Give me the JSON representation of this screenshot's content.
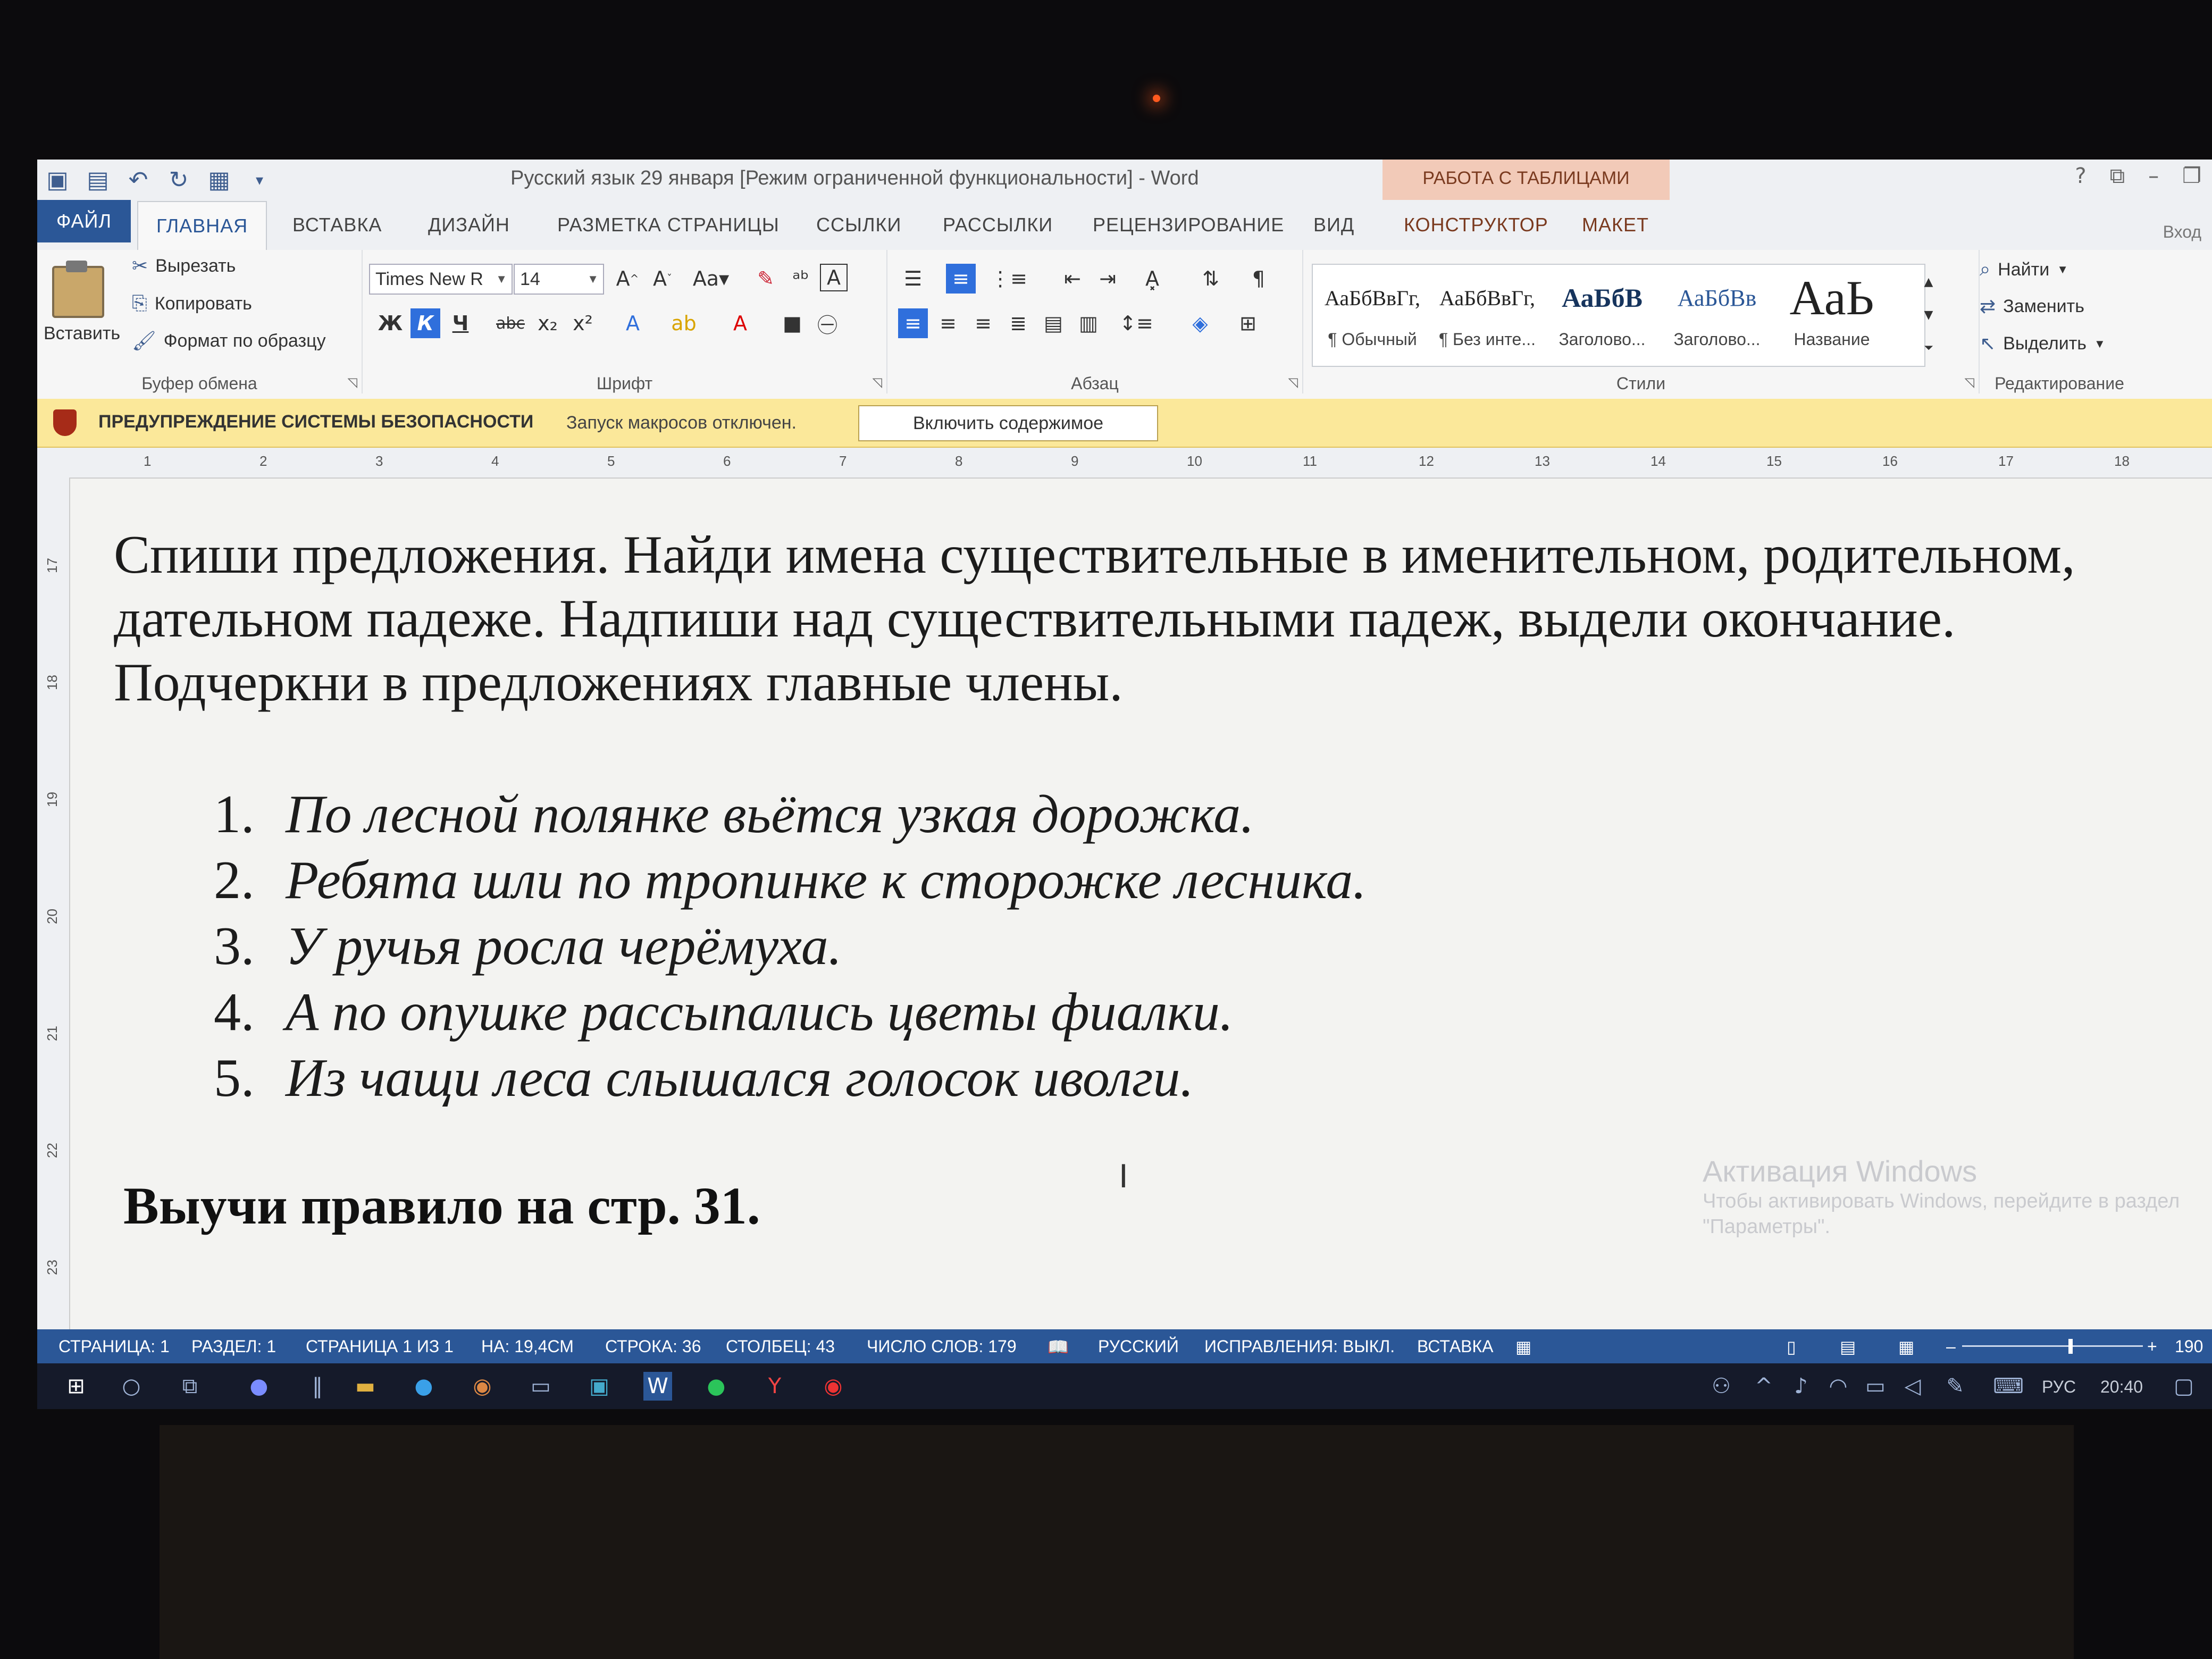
{
  "window": {
    "title": "Русский язык 29 января [Режим ограниченной функциональности] - Word",
    "context_group": "РАБОТА С ТАБЛИЦАМИ",
    "login": "Вход"
  },
  "tabs": {
    "file": "ФАЙЛ",
    "home": "ГЛАВНАЯ",
    "insert": "ВСТАВКА",
    "design": "ДИЗАЙН",
    "layout": "РАЗМЕТКА СТРАНИЦЫ",
    "references": "ССЫЛКИ",
    "mailings": "РАССЫЛКИ",
    "review": "РЕЦЕНЗИРОВАНИЕ",
    "view": "ВИД",
    "table_design": "КОНСТРУКТОР",
    "table_layout": "МАКЕТ"
  },
  "ribbon": {
    "clipboard": {
      "paste": "Вставить",
      "cut": "Вырезать",
      "copy": "Копировать",
      "format_painter": "Формат по образцу",
      "label": "Буфер обмена"
    },
    "font": {
      "name": "Times New R",
      "size": "14",
      "bold": "Ж",
      "italic": "К",
      "underline": "Ч",
      "label": "Шрифт"
    },
    "paragraph": {
      "label": "Абзац"
    },
    "styles": {
      "label": "Стили",
      "items": [
        {
          "sample": "АаБбВвГг,",
          "name": "¶ Обычный"
        },
        {
          "sample": "АаБбВвГг,",
          "name": "¶ Без инте..."
        },
        {
          "sample": "АаБбВ",
          "name": "Заголово..."
        },
        {
          "sample": "АаБбВв",
          "name": "Заголово..."
        },
        {
          "sample": "АаЬ",
          "name": "Название"
        }
      ]
    },
    "editing": {
      "find": "Найти",
      "replace": "Заменить",
      "select": "Выделить",
      "label": "Редактирование"
    }
  },
  "security_bar": {
    "title": "ПРЕДУПРЕЖДЕНИЕ СИСТЕМЫ БЕЗОПАСНОСТИ",
    "message": "Запуск макросов отключен.",
    "button": "Включить содержимое"
  },
  "ruler": {
    "h": [
      "1",
      "2",
      "3",
      "4",
      "5",
      "6",
      "7",
      "8",
      "9",
      "10",
      "11",
      "12",
      "13",
      "14",
      "15",
      "16",
      "17",
      "18"
    ],
    "v": [
      "17",
      "18",
      "19",
      "20",
      "21",
      "22",
      "23"
    ]
  },
  "document": {
    "instruction_lines": [
      "Спиши предложения. Найди имена существительные в именительном, родительном,",
      "дательном падеже. Надпиши над существительными падеж, выдели окончание.",
      "Подчеркни в  предложениях главные члены."
    ],
    "sentences": [
      {
        "n": "1.",
        "text": "По лесной полянке вьётся узкая дорожка."
      },
      {
        "n": "2.",
        "text": "Ребята шли по тропинке к сторожке лесника."
      },
      {
        "n": "3.",
        "text": "У ручья росла черёмуха."
      },
      {
        "n": "4.",
        "text": "А по опушке рассыпались цветы фиалки."
      },
      {
        "n": "5.",
        "text": "Из чащи леса слышался голосок иволги."
      }
    ],
    "rule": "Выучи правило  на стр. 31."
  },
  "activation": {
    "title": "Активация Windows",
    "text": "Чтобы активировать Windows, перейдите в раздел \"Параметры\"."
  },
  "status": {
    "page": "СТРАНИЦА: 1",
    "section": "РАЗДЕЛ: 1",
    "pages": "СТРАНИЦА 1 ИЗ 1",
    "at": "НА: 19,4СМ",
    "line": "СТРОКА: 36",
    "column": "СТОЛБЕЦ: 43",
    "words": "ЧИСЛО СЛОВ: 179",
    "language": "РУССКИЙ",
    "track": "ИСПРАВЛЕНИЯ: ВЫКЛ.",
    "mode": "ВСТАВКА",
    "zoom": "190"
  },
  "taskbar": {
    "lang": "РУС",
    "time": "20:40"
  }
}
